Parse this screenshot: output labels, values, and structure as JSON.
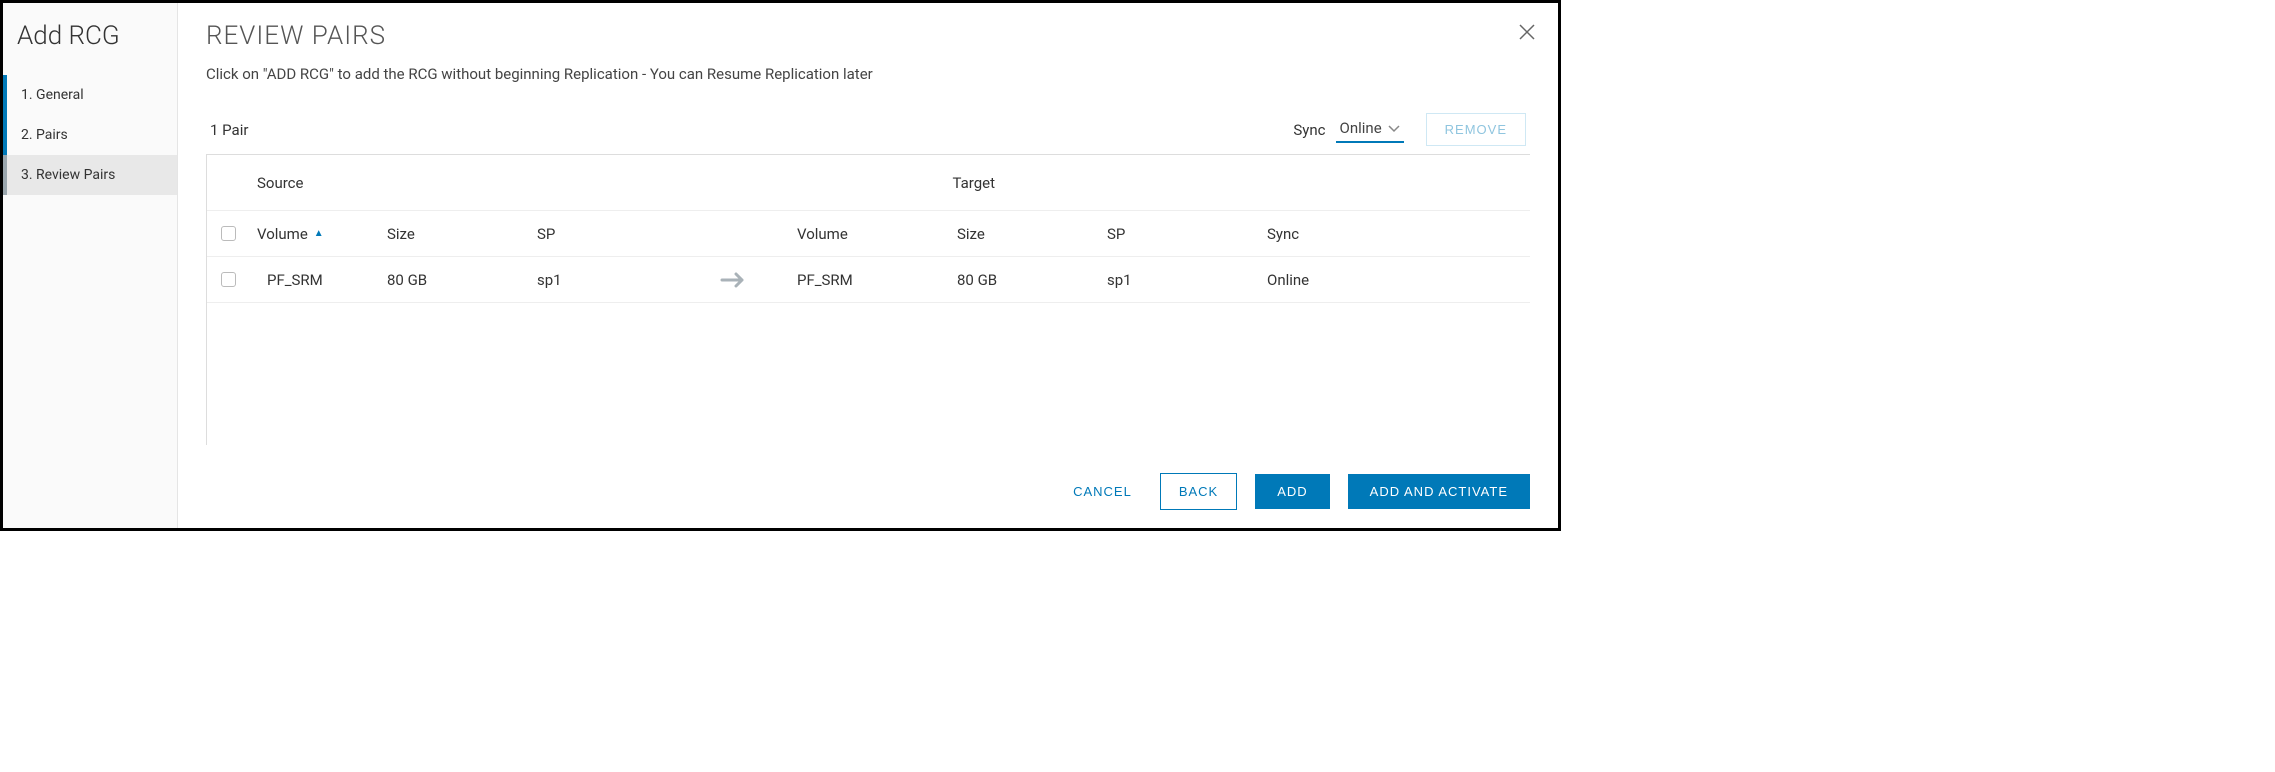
{
  "sidebar": {
    "title": "Add RCG",
    "steps": [
      {
        "label": "1. General"
      },
      {
        "label": "2. Pairs"
      },
      {
        "label": "3. Review Pairs"
      }
    ]
  },
  "main": {
    "title": "REVIEW PAIRS",
    "instruction": "Click on \"ADD RCG\" to add the RCG without beginning Replication - You can Resume Replication later",
    "pairCount": "1 Pair",
    "syncLabel": "Sync",
    "syncValue": "Online",
    "removeBtn": "REMOVE",
    "groupHeaders": {
      "source": "Source",
      "target": "Target"
    },
    "columns": {
      "srcVolume": "Volume",
      "srcSize": "Size",
      "srcSp": "SP",
      "tgtVolume": "Volume",
      "tgtSize": "Size",
      "tgtSp": "SP",
      "sync": "Sync"
    },
    "rows": [
      {
        "srcVolume": "PF_SRM",
        "srcSize": "80 GB",
        "srcSp": "sp1",
        "tgtVolume": "PF_SRM",
        "tgtSize": "80 GB",
        "tgtSp": "sp1",
        "sync": "Online"
      }
    ],
    "footer": {
      "cancel": "CANCEL",
      "back": "BACK",
      "add": "ADD",
      "addActivate": "ADD AND ACTIVATE"
    }
  }
}
